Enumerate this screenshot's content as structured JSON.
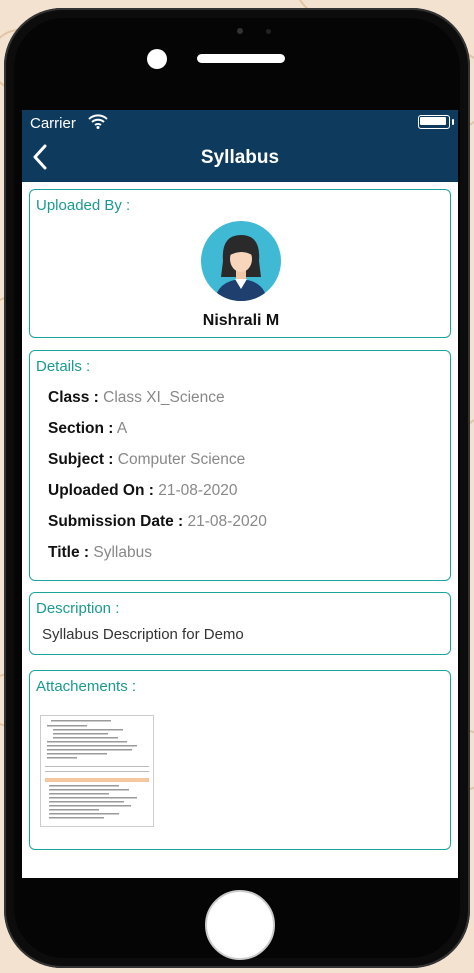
{
  "status_bar": {
    "carrier": "Carrier"
  },
  "header": {
    "title": "Syllabus"
  },
  "uploaded_by": {
    "label": "Uploaded By :",
    "name": "Nishrali  M"
  },
  "details": {
    "label": "Details :",
    "rows": [
      {
        "key": "Class :",
        "value": "Class XI_Science"
      },
      {
        "key": "Section :",
        "value": "A"
      },
      {
        "key": "Subject :",
        "value": "Computer Science"
      },
      {
        "key": "Uploaded On :",
        "value": "21-08-2020"
      },
      {
        "key": "Submission Date :",
        "value": "21-08-2020"
      },
      {
        "key": "Title :",
        "value": "Syllabus"
      }
    ]
  },
  "description": {
    "label": "Description :",
    "text": "Syllabus Description for Demo"
  },
  "attachments": {
    "label": "Attachements :",
    "thumbnail_icon": "document-thumbnail"
  },
  "colors": {
    "nav": "#0e3a5e",
    "accent": "#1aa59a",
    "avatar_bg": "#3fb9d4"
  }
}
